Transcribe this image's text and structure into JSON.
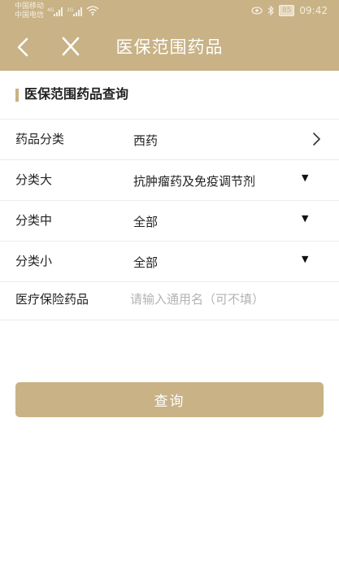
{
  "status_bar": {
    "carrier_1": "中国移动",
    "carrier_2": "中国电信",
    "net_1": "4G",
    "net_2": "2G",
    "battery": "85",
    "time": "09:42"
  },
  "header": {
    "title": "医保范围药品",
    "back_icon": "chevron-left-icon",
    "close_icon": "close-icon",
    "background_color": "#c8b286"
  },
  "section": {
    "title": "医保范围药品查询"
  },
  "form": {
    "rows": [
      {
        "label": "药品分类",
        "value": "西药",
        "control": "chevron-right-icon"
      },
      {
        "label": "分类大",
        "value": "抗肿瘤药及免疫调节剂",
        "control": "dropdown-caret"
      },
      {
        "label": "分类中",
        "value": "全部",
        "control": "dropdown-caret"
      },
      {
        "label": "分类小",
        "value": "全部",
        "control": "dropdown-caret"
      }
    ],
    "input": {
      "label": "医疗保险药品",
      "placeholder": "请输入通用名（可不填）",
      "value": ""
    }
  },
  "button": {
    "label": "查询",
    "color": "#c8b286"
  }
}
